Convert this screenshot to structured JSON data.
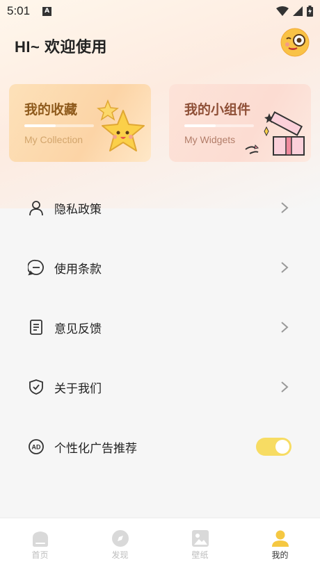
{
  "status_bar": {
    "time": "5:01",
    "notification_icon": "a-icon"
  },
  "header": {
    "greeting": "HI~ 欢迎使用",
    "avatar": "avatar-monocle-face"
  },
  "cards": [
    {
      "title": "我的收藏",
      "subtitle": "My Collection",
      "art": "star-mascot-icon"
    },
    {
      "title": "我的小组件",
      "subtitle": "My Widgets",
      "art": "gift-box-icon"
    }
  ],
  "menu": [
    {
      "label": "隐私政策",
      "icon": "user-icon"
    },
    {
      "label": "使用条款",
      "icon": "chat-icon"
    },
    {
      "label": "意见反馈",
      "icon": "document-icon"
    },
    {
      "label": "关于我们",
      "icon": "shield-check-icon"
    },
    {
      "label": "个性化广告推荐",
      "icon": "ad-icon",
      "toggle_on": true
    }
  ],
  "nav": [
    {
      "label": "首页",
      "icon": "home-icon"
    },
    {
      "label": "发现",
      "icon": "compass-icon"
    },
    {
      "label": "壁纸",
      "icon": "wallpaper-icon"
    },
    {
      "label": "我的",
      "icon": "profile-icon",
      "active": true
    }
  ],
  "colors": {
    "accent_yellow": "#f7dc63",
    "card_collection": "#fcd4a6",
    "card_widgets": "#fcdcd2",
    "nav_active": "#f5c842"
  }
}
